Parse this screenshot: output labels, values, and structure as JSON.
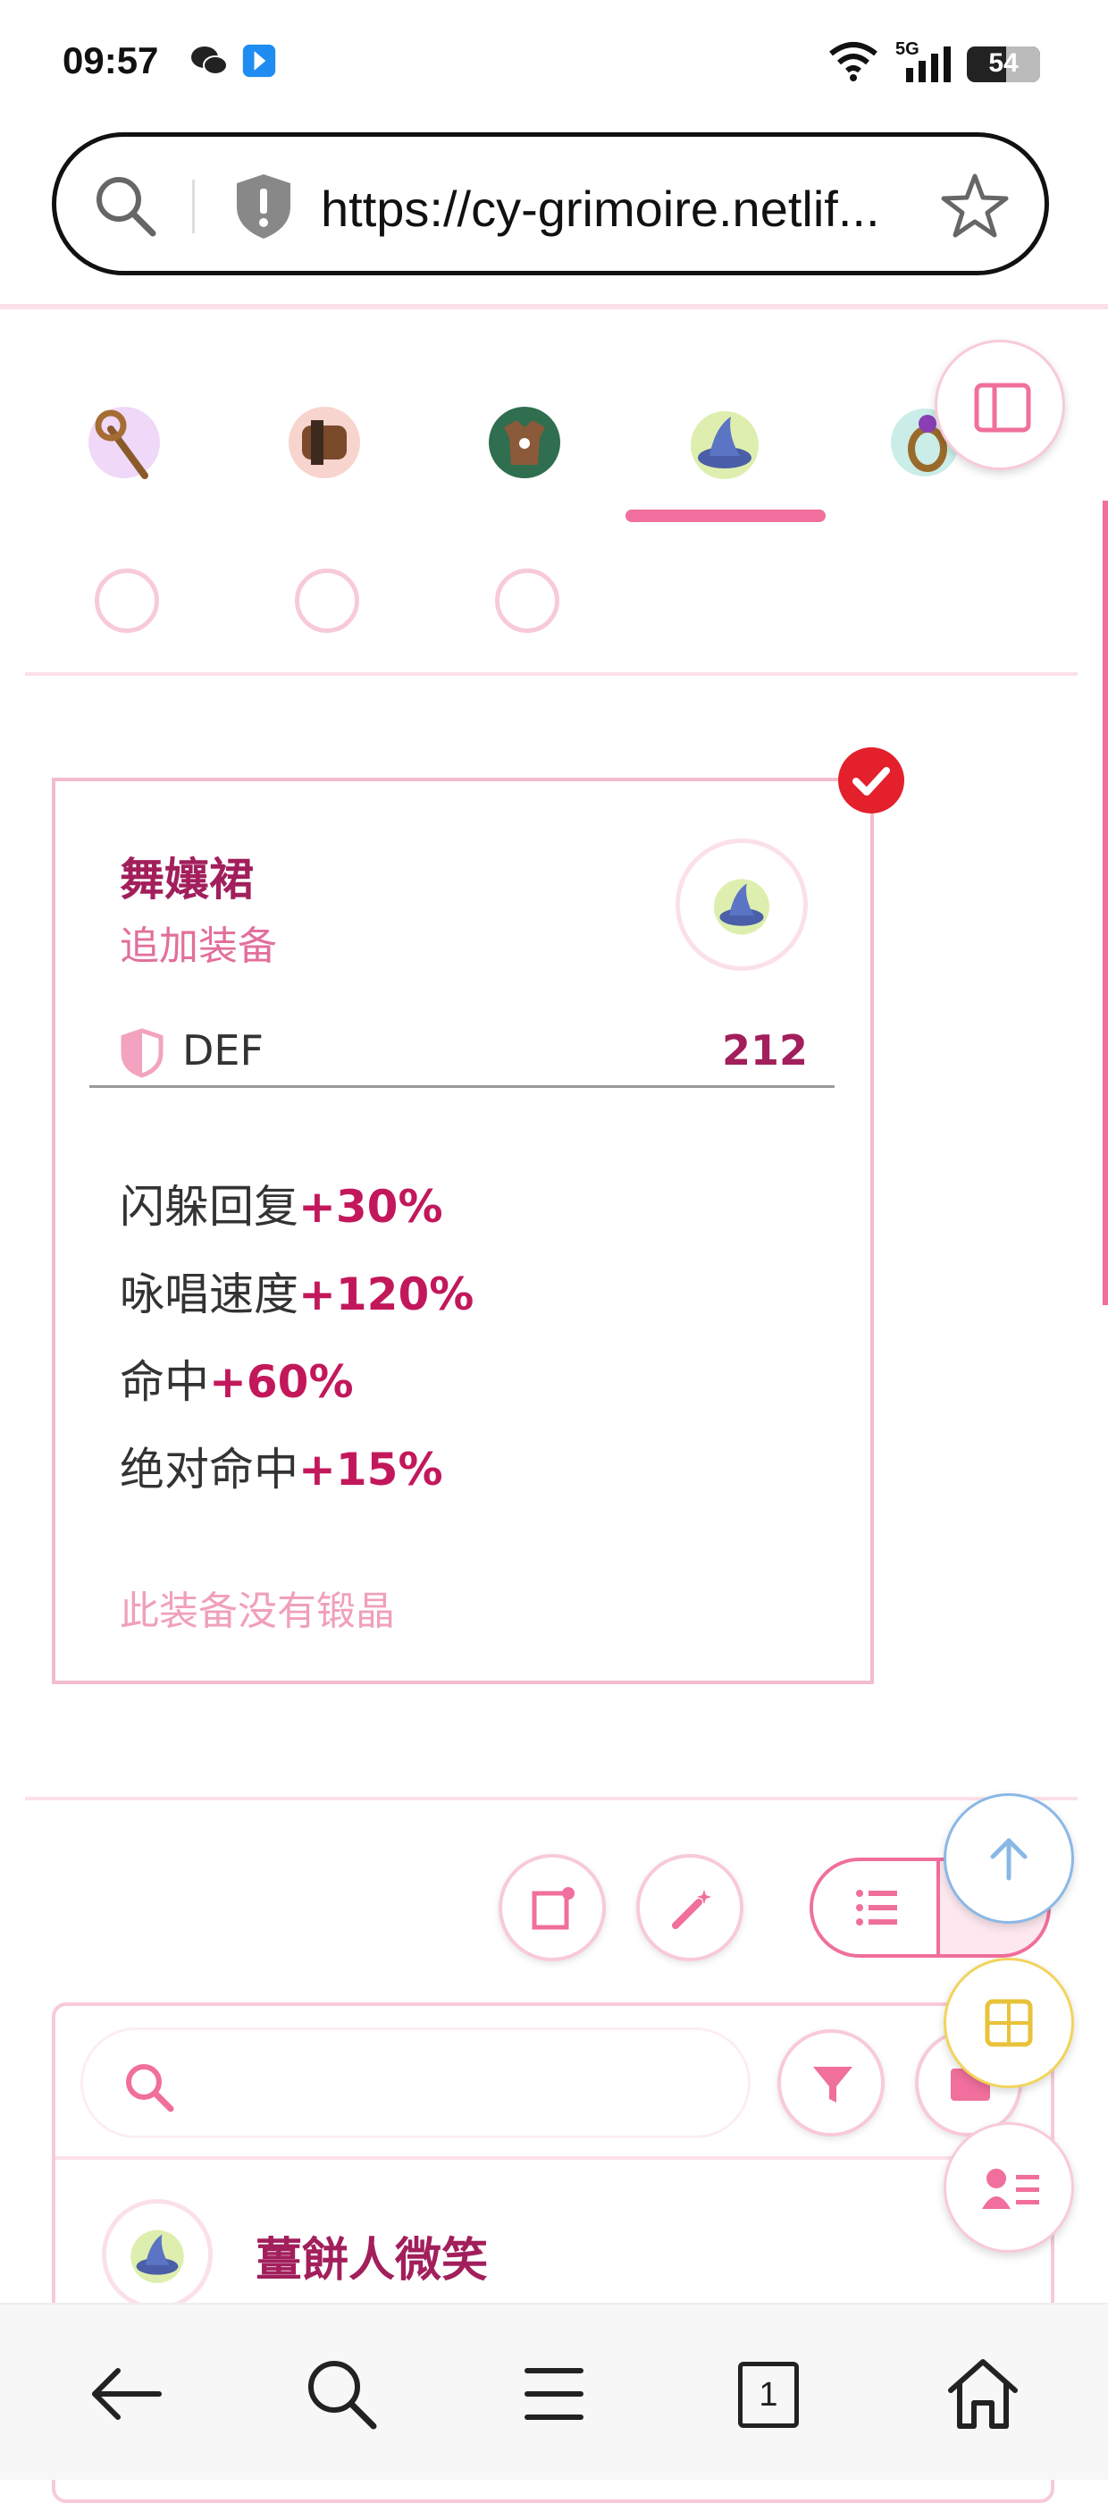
{
  "status_bar": {
    "time": "09:57",
    "icons": [
      "wechat-icon",
      "app-notification-icon",
      "wifi-icon",
      "signal-5g-icon",
      "battery-icon"
    ],
    "network_label": "5G",
    "battery_level": "54"
  },
  "browser": {
    "url": "https://cy-grimoire.netlif...",
    "icons": [
      "search-icon",
      "shield-icon",
      "star-icon"
    ]
  },
  "equipment_tabs": {
    "items": [
      "staff-icon",
      "gauntlet-icon",
      "armor-icon",
      "hat-icon",
      "ring-icon"
    ],
    "active_index": 3
  },
  "equipment_card": {
    "name": "舞孃裙",
    "category": "追加装备",
    "def_label": "DEF",
    "def_value": "212",
    "stats": [
      {
        "label": "闪躲回复",
        "value": "+30%"
      },
      {
        "label": "咏唱速度",
        "value": "+120%"
      },
      {
        "label": "命中",
        "value": "+60%"
      },
      {
        "label": "绝对命中",
        "value": "+15%"
      }
    ],
    "crystal_note": "此装备没有锻晶"
  },
  "list": {
    "first_item_name": "薑餅人微笑"
  },
  "colors": {
    "accent": "#f06f9c",
    "accent_dark": "#a21f5c",
    "stat_value": "#c2185b",
    "border_pink": "#f8cad9",
    "check_red": "#e3202b",
    "scroll_blue": "#8ab8e6",
    "calc_yellow": "#f2d45c"
  },
  "nav_bar": [
    "back-icon",
    "search-icon",
    "menu-icon",
    "tabs-icon",
    "home-icon"
  ],
  "tabs_count": "1"
}
